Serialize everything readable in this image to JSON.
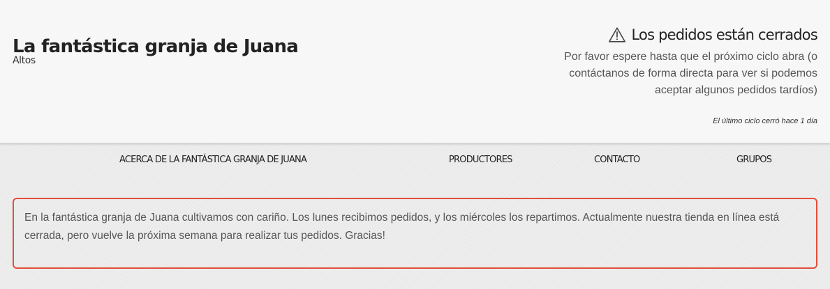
{
  "header": {
    "shop_title": "La fantástica granja de Juana",
    "subtitle": "Altos",
    "closed_notice": {
      "icon": "warning-triangle-icon",
      "title": "Los pedidos están cerrados",
      "message": "Por favor espere hasta que el próximo ciclo abra (o contáctanos de forma directa para ver si podemos aceptar algunos pedidos tardíos)",
      "last_cycle": "El último ciclo cerró hace 1 día"
    }
  },
  "nav": {
    "items": [
      "ACERCA DE LA FANTÁSTICA GRANJA DE JUANA",
      "PRODUCTORES",
      "CONTACTO",
      "GRUPOS"
    ]
  },
  "notice": {
    "text": "En la fantástica granja de Juana cultivamos con cariño. Los lunes recibimos pedidos, y los miércoles los repartimos. Actualmente nuestra tienda en línea está cerrada, pero vuelve la próxima semana para realizar tus pedidos. Gracias!",
    "border_color": "#e44d3b"
  },
  "colors": {
    "header_background": "#f7f7f7",
    "page_background": "#ececec",
    "accent": "#e44d3b"
  }
}
